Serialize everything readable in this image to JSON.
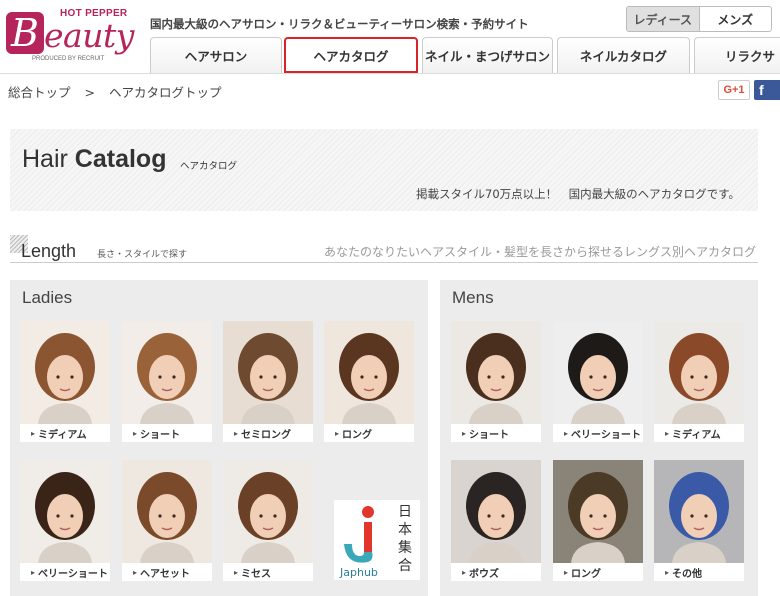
{
  "header": {
    "logo": {
      "hp": "HOT PEPPER",
      "b": "B",
      "eauty": "eauty",
      "byline": "PRODUCED BY RECRUIT"
    },
    "tagline": "国内最大級のヘアサロン・リラク＆ビューティーサロン検索・予約サイト",
    "gender": {
      "ladies": "レディース",
      "mens": "メンズ"
    },
    "nav": [
      {
        "label": "ヘアサロン"
      },
      {
        "label": "ヘアカタログ"
      },
      {
        "label": "ネイル・まつげサロン"
      },
      {
        "label": "ネイルカタログ"
      },
      {
        "label": "リラクサ"
      }
    ]
  },
  "breadcrumb": {
    "home": "総合トップ",
    "sep": ">",
    "current": "ヘアカタログトップ"
  },
  "social": {
    "gplus": "G+1",
    "fb": "f"
  },
  "banner": {
    "title_light": "Hair ",
    "title_bold": "Catalog",
    "subtitle": "ヘアカタログ",
    "desc": "掲載スタイル70万点以上！　国内最大級のヘアカタログです。"
  },
  "length": {
    "title": "Length",
    "subtitle": "長さ・スタイルで探す",
    "desc": "あなたのなりたいヘアスタイル・髪型を長さから探せるレングス別ヘアカタログ"
  },
  "ladies": {
    "title": "Ladies",
    "items": [
      {
        "label": "ミディアム",
        "hair": "#8a5530",
        "bg": "#f3ece4"
      },
      {
        "label": "ショート",
        "hair": "#9a6238",
        "bg": "#f2ede8"
      },
      {
        "label": "セミロング",
        "hair": "#6e4a30",
        "bg": "#e8ddd2"
      },
      {
        "label": "ロング",
        "hair": "#5a3520",
        "bg": "#efe6de"
      },
      {
        "label": "ベリーショート",
        "hair": "#3a2418",
        "bg": "#f0ece8"
      },
      {
        "label": "ヘアセット",
        "hair": "#7a4a2a",
        "bg": "#efe8e0"
      },
      {
        "label": "ミセス",
        "hair": "#6a4026",
        "bg": "#eeeae6"
      }
    ],
    "japhub": {
      "name": "Japhub",
      "kanji": [
        "日",
        "本",
        "集",
        "合"
      ]
    }
  },
  "mens": {
    "title": "Mens",
    "items": [
      {
        "label": "ショート",
        "hair": "#4a2e1e",
        "bg": "#ece8e4"
      },
      {
        "label": "ベリーショート",
        "hair": "#1e1a18",
        "bg": "#eeeeee"
      },
      {
        "label": "ミディアム",
        "hair": "#8a4a2a",
        "bg": "#eceae6"
      },
      {
        "label": "ボウズ",
        "hair": "#2a2422",
        "bg": "#d9d4d0"
      },
      {
        "label": "ロング",
        "hair": "#4a3a26",
        "bg": "#8a8478"
      },
      {
        "label": "その他",
        "hair": "#3a5aa8",
        "bg": "#b6b6b8"
      }
    ]
  },
  "colors": {
    "brand": "#b5245a",
    "highlight": "#d8232a",
    "panel": "#ececec"
  }
}
